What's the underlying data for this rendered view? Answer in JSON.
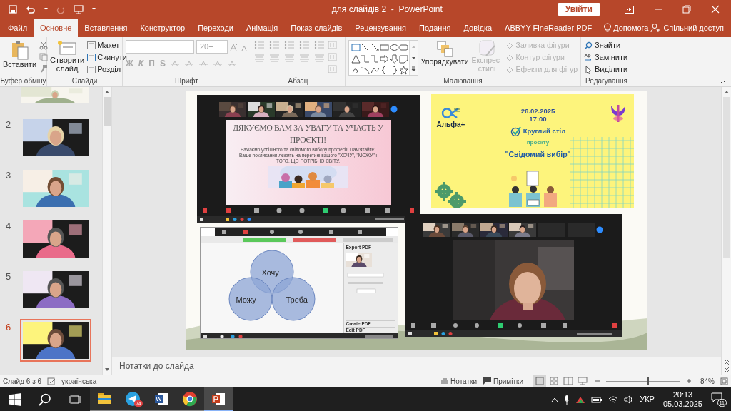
{
  "window": {
    "title": "для слайдів 2  -  PowerPoint",
    "sign_in": "Увійти"
  },
  "tabs": [
    {
      "label": "Файл",
      "selected": false
    },
    {
      "label": "Основне",
      "selected": true
    },
    {
      "label": "Вставлення",
      "selected": false
    },
    {
      "label": "Конструктор",
      "selected": false
    },
    {
      "label": "Переходи",
      "selected": false
    },
    {
      "label": "Анімація",
      "selected": false
    },
    {
      "label": "Показ слайдів",
      "selected": false
    },
    {
      "label": "Рецензування",
      "selected": false
    },
    {
      "label": "Подання",
      "selected": false
    },
    {
      "label": "Довідка",
      "selected": false
    },
    {
      "label": "ABBYY FineReader PDF",
      "selected": false
    }
  ],
  "tell_me": "Допомога",
  "share": "Спільний доступ",
  "ribbon": {
    "clipboard": {
      "paste": "Вставити",
      "label": "Буфер обміну"
    },
    "slides": {
      "new_slide": "Створити слайд",
      "items": [
        "Макет",
        "Скинути",
        "Розділ"
      ],
      "label": "Слайди"
    },
    "font": {
      "size": "20+",
      "styles": [
        "Ж",
        "К",
        "П",
        "S"
      ],
      "label": "Шрифт"
    },
    "paragraph": {
      "label": "Абзац"
    },
    "drawing": {
      "arrange": "Упорядкувати",
      "quick_styles": {
        "label": "Експрес-стилі",
        "disabled": true
      },
      "shape_options": [
        {
          "label": "Заливка фігури",
          "disabled": true
        },
        {
          "label": "Контур фігури",
          "disabled": true
        },
        {
          "label": "Ефекти для фігур",
          "disabled": true
        }
      ],
      "label": "Малювання"
    },
    "editing": {
      "items": [
        {
          "label": "Знайти",
          "kind": "find"
        },
        {
          "label": "Замінити",
          "kind": "replace"
        },
        {
          "label": "Виділити",
          "kind": "select"
        }
      ],
      "label": "Редагування"
    }
  },
  "slides_panel": [
    {
      "number": "2",
      "selected": false
    },
    {
      "number": "3",
      "selected": false
    },
    {
      "number": "4",
      "selected": false
    },
    {
      "number": "5",
      "selected": false
    },
    {
      "number": "6",
      "selected": true
    }
  ],
  "slide": {
    "thanks_screen": {
      "heading": "ДЯКУЄМО ВАМ ЗА УВАГУ ТА УЧАСТЬ У ПРОЄКТІ!",
      "body": "Бажаємо успішного та свідомого вибору професії! Пам'ятайте: Ваше покликання лежить на перетині вашого \"ХОЧУ\", \"МОЖУ\" і ТОГО, ЩО ПОТРІБНО СВІТУ."
    },
    "announcement": {
      "logo": "Альфа+",
      "date": "26.02.2025",
      "time": "17:00",
      "title": "Круглий стіл",
      "subtitle": "проєкту",
      "project": "\"Свідомий вибір\""
    },
    "venn": {
      "circles": [
        "Хочу",
        "Можу",
        "Треба"
      ],
      "panel": [
        "Export PDF",
        "Create PDF",
        "Edit PDF"
      ]
    }
  },
  "notes_placeholder": "Нотатки до слайда",
  "status_bar": {
    "slide": "Слайд 6 з 6",
    "language": "українська",
    "notes": "Нотатки",
    "comments": "Примітки",
    "zoom": "84%",
    "zoom_slider": {
      "level": 0.56
    }
  },
  "taskbar": {
    "apps": [
      {
        "kind": "explorer",
        "active": false
      },
      {
        "kind": "telegram",
        "badge": "74",
        "active": false
      },
      {
        "kind": "word",
        "active": false
      },
      {
        "kind": "chrome",
        "active": false
      },
      {
        "kind": "powerpoint",
        "active": true
      }
    ],
    "language": "УКР",
    "time": "20:13",
    "date": "05.03.2025",
    "notifications": "11"
  }
}
